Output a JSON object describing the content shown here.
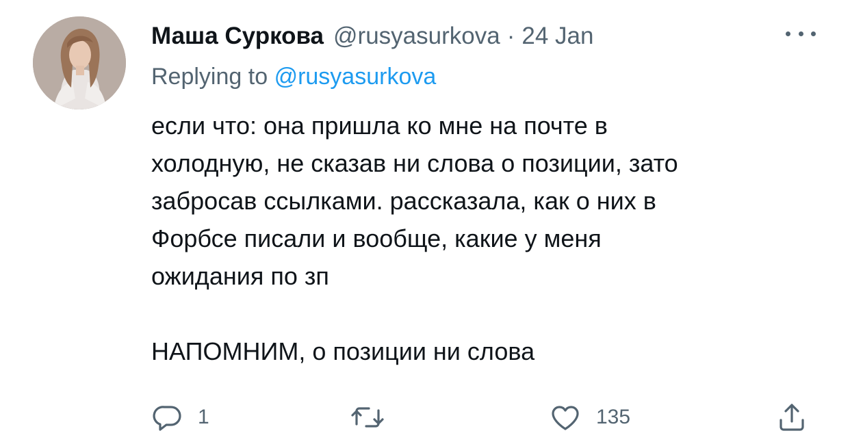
{
  "tweet": {
    "author_name": "Маша Суркова",
    "author_handle": "@rusyasurkova",
    "separator": "·",
    "date": "24 Jan",
    "replying_prefix": "Replying to",
    "replying_handle": "@rusyasurkova",
    "body_lines": [
      "если что: она пришла ко мне на почте в",
      "холодную, не сказав ни слова о позиции, зато",
      "забросав ссылками. рассказала, как о них в",
      "Форбсе писали и вообще, какие у меня",
      "ожидания по зп"
    ],
    "body_second_paragraph": "НАПОМНИМ, о позиции ни слова"
  },
  "actions": {
    "reply": {
      "icon": "reply-icon",
      "count": "1"
    },
    "retweet": {
      "icon": "retweet-icon",
      "count": ""
    },
    "like": {
      "icon": "heart-icon",
      "count": "135"
    },
    "share": {
      "icon": "share-icon",
      "count": ""
    }
  },
  "colors": {
    "text": "#0f1419",
    "secondary": "#536471",
    "link": "#1d9bf0",
    "background": "#ffffff"
  }
}
